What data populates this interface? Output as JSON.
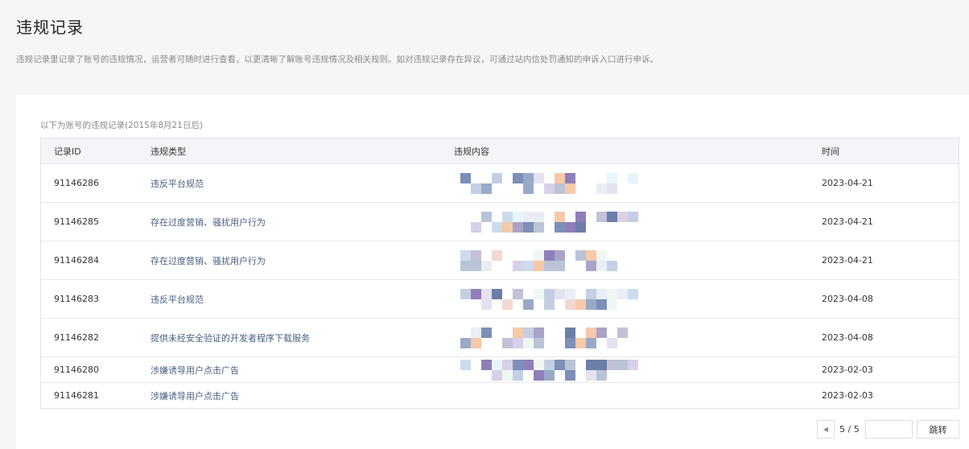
{
  "page": {
    "title": "违规记录",
    "description": "违规记录里记录了账号的违规情况，运营者可随时进行查看，以更清晰了解账号违规情况及相关规则。如对违规记录存在异议，可通过站内信处罚通知的申诉入口进行申诉。"
  },
  "records": {
    "caption": "以下为账号的违规记录(2015年8月21日后)",
    "columns": [
      "记录ID",
      "违规类型",
      "违规内容",
      "时间"
    ],
    "rows": [
      {
        "id": "91146286",
        "type": "违反平台规范",
        "time": "2023-04-21"
      },
      {
        "id": "91146285",
        "type": "存在过度营销、骚扰用户行为",
        "time": "2023-04-21"
      },
      {
        "id": "91146284",
        "type": "存在过度营销、骚扰用户行为",
        "time": "2023-04-21"
      },
      {
        "id": "91146283",
        "type": "违反平台规范",
        "time": "2023-04-08"
      },
      {
        "id": "91146282",
        "type": "提供未经安全验证的开发者程序下载服务",
        "time": "2023-04-08"
      },
      {
        "id": "91146280",
        "type": "涉嫌诱导用户点击广告",
        "time": "2023-02-03"
      },
      {
        "id": "91146281",
        "type": "涉嫌诱导用户点击广告",
        "time": "2023-02-03"
      }
    ]
  },
  "pagination": {
    "prev_icon": "caret-left-icon",
    "page_text": "5 / 5",
    "input_value": "",
    "jump_label": "跳转"
  },
  "colors": {
    "link_text": "#4a5f80",
    "header_bg": "#f4f5f9",
    "page_bg": "#f6f6f8"
  }
}
